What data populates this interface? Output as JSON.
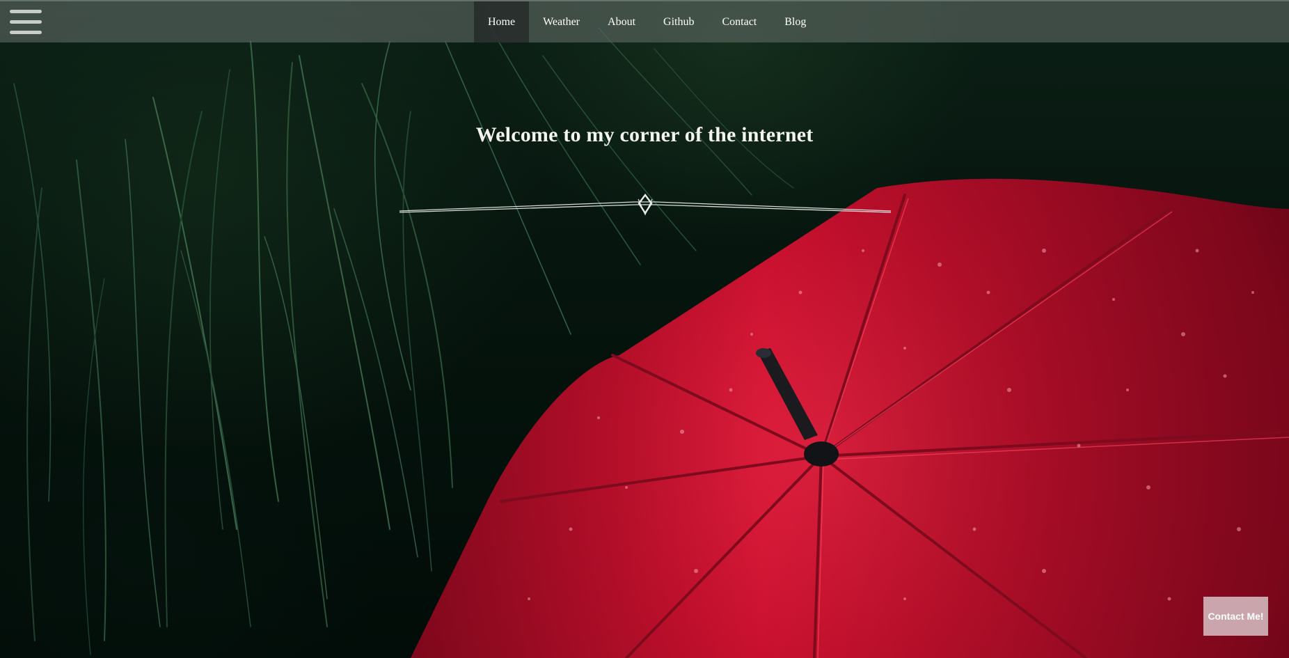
{
  "nav": {
    "items": [
      {
        "label": "Home",
        "active": true
      },
      {
        "label": "Weather",
        "active": false
      },
      {
        "label": "About",
        "active": false
      },
      {
        "label": "Github",
        "active": false
      },
      {
        "label": "Contact",
        "active": false
      },
      {
        "label": "Blog",
        "active": false
      }
    ],
    "menu_icon": "hamburger-menu-icon"
  },
  "hero": {
    "title": "Welcome to my corner of the internet",
    "background": "red umbrella with raindrops over dark green grass"
  },
  "contact_button": {
    "label": "Contact Me!"
  },
  "colors": {
    "umbrella_red": "#c8102e",
    "grass_green": "#0c2a19",
    "nav_bar": "#5f6964",
    "nav_active": "#232826",
    "text": "#ffffff"
  }
}
